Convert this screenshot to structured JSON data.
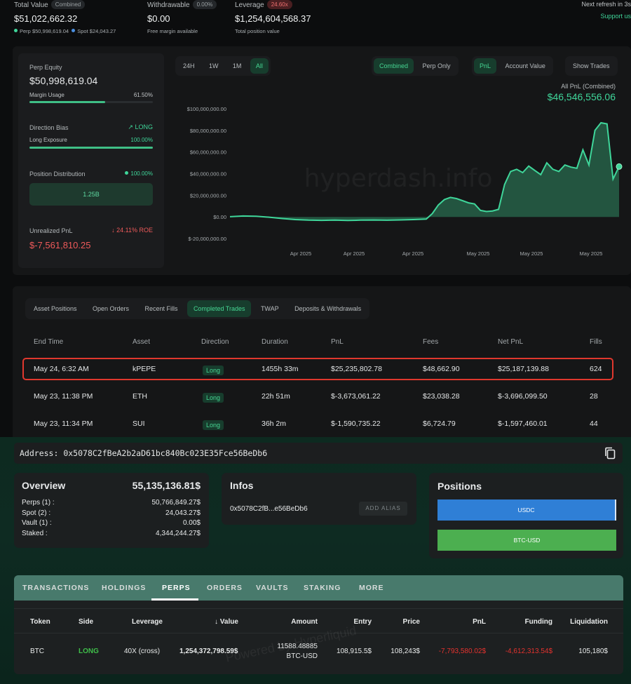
{
  "top": {
    "total_value_label": "Total Value",
    "total_value_badge": "Combined",
    "total_value": "$51,022,662.32",
    "perp_label": "Perp",
    "perp_value": "$50,998,619.04",
    "spot_label": "Spot",
    "spot_value": "$24,043.27",
    "withdrawable_label": "Withdrawable",
    "withdrawable_badge": "0.00%",
    "withdrawable_value": "$0.00",
    "withdrawable_sub": "Free margin available",
    "leverage_label": "Leverage",
    "leverage_badge": "24.60x",
    "leverage_value": "$1,254,604,568.37",
    "leverage_sub": "Total position value",
    "refresh_text": "Next refresh in 3s",
    "support_text": "Support us"
  },
  "equity": {
    "perp_equity_label": "Perp Equity",
    "perp_equity_value": "$50,998,619.04",
    "margin_usage_label": "Margin Usage",
    "margin_usage_value": "61.50%",
    "margin_usage_fraction": 0.615,
    "direction_bias_label": "Direction Bias",
    "direction_bias_value": "LONG",
    "long_exposure_label": "Long Exposure",
    "long_exposure_value": "100.00%",
    "long_exposure_fraction": 1.0,
    "position_distribution_label": "Position Distribution",
    "position_distribution_value": "100.00%",
    "distribution_box": "1.25B",
    "unrealized_label": "Unrealized PnL",
    "unrealized_roe": "24.11% ROE",
    "unrealized_value": "$-7,561,810.25"
  },
  "chart_controls": {
    "ranges": [
      "24H",
      "1W",
      "1M",
      "All"
    ],
    "active_range": "All",
    "mode_buttons": [
      "Combined",
      "Perp Only"
    ],
    "metric_buttons": [
      "PnL",
      "Account Value"
    ],
    "show_trades": "Show Trades",
    "summary_label": "All PnL (Combined)",
    "summary_value": "$46,546,556.06",
    "watermark": "hyperdash.info"
  },
  "chart_data": {
    "type": "area",
    "title": "",
    "xlabel": "",
    "ylabel": "",
    "ylim": [
      -20000000,
      100000000
    ],
    "yticks": [
      "$100,000,000.00",
      "$80,000,000.00",
      "$60,000,000.00",
      "$40,000,000.00",
      "$20,000,000.00",
      "$0.00",
      "$-20,000,000.00"
    ],
    "xticks": [
      "Apr 2025",
      "Apr 2025",
      "Apr 2025",
      "May 2025",
      "May 2025",
      "May 2025"
    ],
    "grid": false,
    "series": [
      {
        "values": [
          200000,
          800000,
          600000,
          -300000,
          -1500000,
          -2500000,
          -3000000,
          -3200000,
          -3000000,
          -3300000,
          -3000000,
          -2900000,
          -3100000,
          -2800000,
          -2500000,
          -2000000,
          3000000,
          11000000,
          16000000,
          18000000,
          17000000,
          15000000,
          13000000,
          12000000,
          6000000,
          5000000,
          5500000,
          7000000,
          30000000,
          42000000,
          44000000,
          41000000,
          47000000,
          43000000,
          39000000,
          50000000,
          44000000,
          42000000,
          48000000,
          46000000,
          45000000,
          62000000,
          48000000,
          80000000,
          87000000,
          86000000,
          35000000,
          46546556
        ]
      }
    ]
  },
  "trades": {
    "tabs": [
      "Asset Positions",
      "Open Orders",
      "Recent Fills",
      "Completed Trades",
      "TWAP",
      "Deposits & Withdrawals"
    ],
    "active_tab": "Completed Trades",
    "headers": [
      "End Time",
      "Asset",
      "Direction",
      "Duration",
      "PnL",
      "Fees",
      "Net PnL",
      "Fills"
    ],
    "rows": [
      {
        "end": "May 24, 6:32 AM",
        "asset": "kPEPE",
        "dir": "Long",
        "duration": "1455h 33m",
        "pnl": "$25,235,802.78",
        "fees": "$48,662.90",
        "net": "$25,187,139.88",
        "fills": "624"
      },
      {
        "end": "May 23, 11:38 PM",
        "asset": "ETH",
        "dir": "Long",
        "duration": "22h 51m",
        "pnl": "$-3,673,061.22",
        "fees": "$23,038.28",
        "net": "$-3,696,099.50",
        "fills": "28"
      },
      {
        "end": "May 23, 11:34 PM",
        "asset": "SUI",
        "dir": "Long",
        "duration": "36h 2m",
        "pnl": "$-1,590,735.22",
        "fees": "$6,724.79",
        "net": "$-1,597,460.01",
        "fills": "44"
      }
    ]
  },
  "address": {
    "label": "Address:",
    "value": "0x5078C2fBeA2b2aD61bc840Bc023E35Fce56BeDb6"
  },
  "overview": {
    "title": "Overview",
    "total": "55,135,136.81$",
    "rows": [
      {
        "label": "Perps (1) :",
        "value": "50,766,849.27$"
      },
      {
        "label": "Spot (2) :",
        "value": "24,043.27$"
      },
      {
        "label": "Vault (1) :",
        "value": "0.00$"
      },
      {
        "label": "Staked :",
        "value": "4,344,244.27$"
      }
    ]
  },
  "infos": {
    "title": "Infos",
    "short_address": "0x5078C2fB...e56BeDb6",
    "alias_button": "ADD ALIAS"
  },
  "positions": {
    "title": "Positions",
    "bars": [
      {
        "label": "USDC",
        "color": "#2f7fd6"
      },
      {
        "label": "BTC-USD",
        "color": "#4caf50"
      }
    ]
  },
  "bottom": {
    "tabs": [
      "TRANSACTIONS",
      "HOLDINGS",
      "PERPS",
      "ORDERS",
      "VAULTS",
      "STAKING",
      "MORE"
    ],
    "active_tab": "PERPS",
    "headers": [
      "Token",
      "Side",
      "Leverage",
      "Value",
      "Amount",
      "Entry",
      "Price",
      "PnL",
      "Funding",
      "Liquidation"
    ],
    "row": {
      "token": "BTC",
      "side": "LONG",
      "leverage": "40X (cross)",
      "value": "1,254,372,798.59$",
      "amount_line1": "11588.48885",
      "amount_line2": "BTC-USD",
      "entry": "108,915.5$",
      "price": "108,243$",
      "pnl": "-7,793,580.02$",
      "funding": "-4,612,313.54$",
      "liquidation": "105,180$"
    },
    "watermark": "Powered by Hyperliquid"
  }
}
